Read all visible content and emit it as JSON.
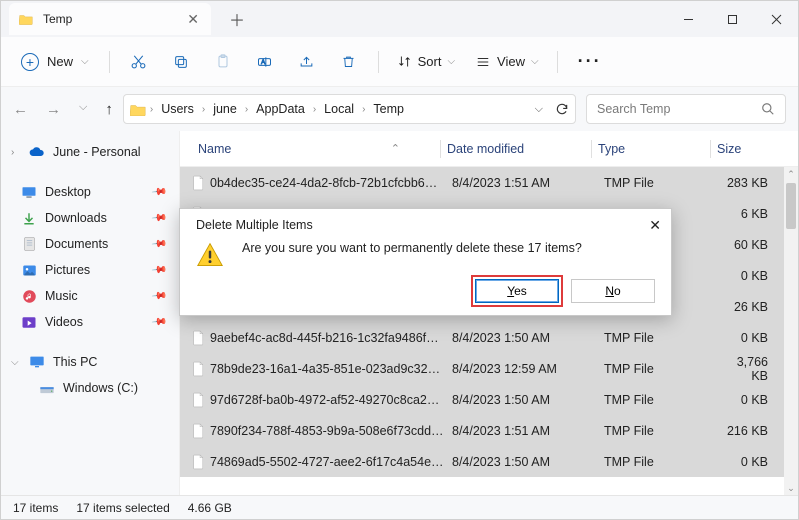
{
  "window": {
    "title": "Temp"
  },
  "toolbar": {
    "new_label": "New",
    "sort_label": "Sort",
    "view_label": "View"
  },
  "breadcrumbs": [
    "Users",
    "june",
    "AppData",
    "Local",
    "Temp"
  ],
  "search": {
    "placeholder": "Search Temp"
  },
  "sidebar": {
    "onedrive": "June - Personal",
    "items": [
      {
        "icon": "desktop",
        "label": "Desktop"
      },
      {
        "icon": "downloads",
        "label": "Downloads"
      },
      {
        "icon": "documents",
        "label": "Documents"
      },
      {
        "icon": "pictures",
        "label": "Pictures"
      },
      {
        "icon": "music",
        "label": "Music"
      },
      {
        "icon": "videos",
        "label": "Videos"
      }
    ],
    "thispc": "This PC",
    "drive": "Windows (C:)"
  },
  "columns": {
    "name": "Name",
    "date": "Date modified",
    "type": "Type",
    "size": "Size"
  },
  "files": [
    {
      "name": "0b4dec35-ce24-4da2-8fcb-72b1cfcbb657...",
      "date": "8/4/2023 1:51 AM",
      "type": "TMP File",
      "size": "283 KB",
      "selected": true
    },
    {
      "name": "",
      "date": "",
      "type": "",
      "size": "6 KB",
      "selected": true
    },
    {
      "name": "",
      "date": "",
      "type": "",
      "size": "60 KB",
      "selected": true
    },
    {
      "name": "",
      "date": "",
      "type": "",
      "size": "0 KB",
      "selected": true
    },
    {
      "name": "",
      "date": "",
      "type": "",
      "size": "26 KB",
      "selected": true
    },
    {
      "name": "9aebef4c-ac8d-445f-b216-1c32fa9486f9.t...",
      "date": "8/4/2023 1:50 AM",
      "type": "TMP File",
      "size": "0 KB",
      "selected": true
    },
    {
      "name": "78b9de23-16a1-4a35-851e-023ad9c32e6f...",
      "date": "8/4/2023 12:59 AM",
      "type": "TMP File",
      "size": "3,766 KB",
      "selected": true
    },
    {
      "name": "97d6728f-ba0b-4972-af52-49270c8ca2b8...",
      "date": "8/4/2023 1:50 AM",
      "type": "TMP File",
      "size": "0 KB",
      "selected": true
    },
    {
      "name": "7890f234-788f-4853-9b9a-508e6f73cdde.t...",
      "date": "8/4/2023 1:51 AM",
      "type": "TMP File",
      "size": "216 KB",
      "selected": true
    },
    {
      "name": "74869ad5-5502-4727-aee2-6f17c4a54e74...",
      "date": "8/4/2023 1:50 AM",
      "type": "TMP File",
      "size": "0 KB",
      "selected": true
    }
  ],
  "dialog": {
    "title": "Delete Multiple Items",
    "message": "Are you sure you want to permanently delete these 17 items?",
    "yes": "Yes",
    "no": "No"
  },
  "status": {
    "count": "17 items",
    "selected": "17 items selected",
    "size": "4.66 GB"
  }
}
